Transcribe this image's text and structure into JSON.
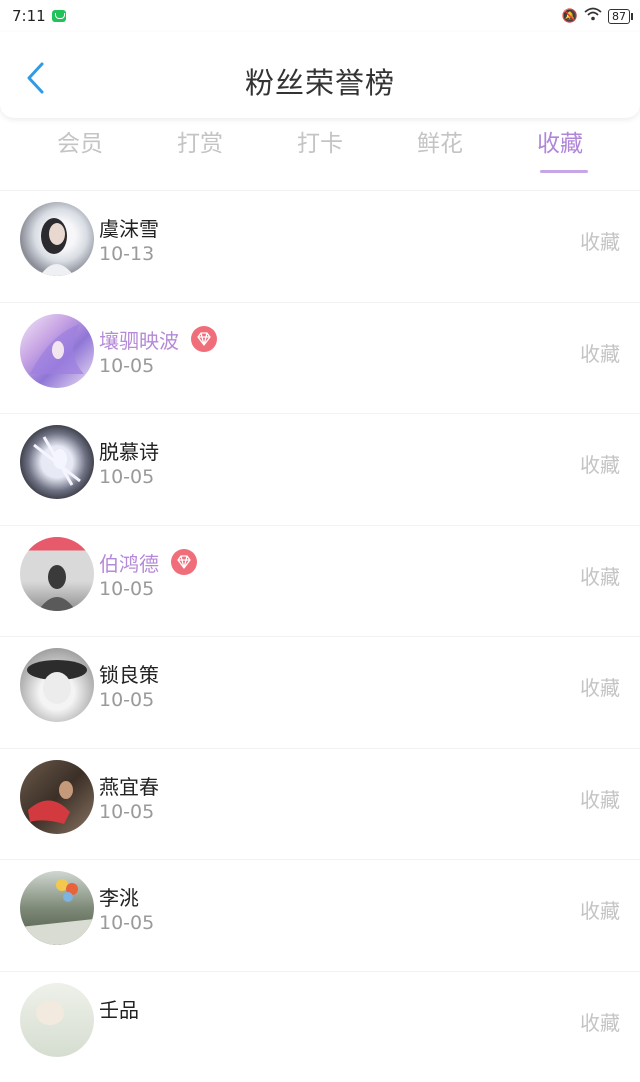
{
  "status_bar": {
    "time": "7:11",
    "battery": "87"
  },
  "header": {
    "title": "粉丝荣誉榜"
  },
  "tabs": [
    {
      "label": "会员",
      "active": false
    },
    {
      "label": "打赏",
      "active": false
    },
    {
      "label": "打卡",
      "active": false
    },
    {
      "label": "鲜花",
      "active": false
    },
    {
      "label": "收藏",
      "active": true
    }
  ],
  "colors": {
    "accent": "#b086d9",
    "vip_name": "#b58ad8",
    "vip_badge": "#f06e79",
    "inactive": "#c4c4c4"
  },
  "list": [
    {
      "name": "虞沫雪",
      "date": "10-13",
      "action": "收藏",
      "vip": false
    },
    {
      "name": "壤驷映波",
      "date": "10-05",
      "action": "收藏",
      "vip": true
    },
    {
      "name": "脱慕诗",
      "date": "10-05",
      "action": "收藏",
      "vip": false
    },
    {
      "name": "伯鸿德",
      "date": "10-05",
      "action": "收藏",
      "vip": true
    },
    {
      "name": "锁良策",
      "date": "10-05",
      "action": "收藏",
      "vip": false
    },
    {
      "name": "燕宜春",
      "date": "10-05",
      "action": "收藏",
      "vip": false
    },
    {
      "name": "李洮",
      "date": "10-05",
      "action": "收藏",
      "vip": false
    },
    {
      "name": "壬品",
      "date": "",
      "action": "收藏",
      "vip": false
    }
  ]
}
